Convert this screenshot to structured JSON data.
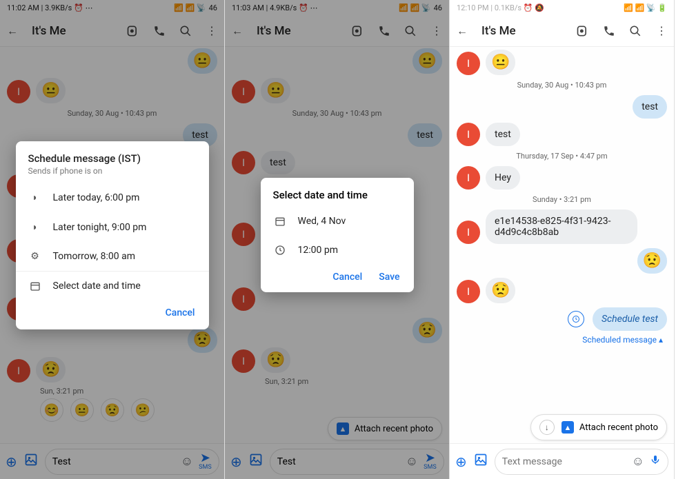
{
  "panel1": {
    "status": {
      "time": "11:02 AM",
      "speed": "3.9KB/s",
      "battery": "46"
    },
    "title": "It's Me",
    "chat": {
      "ts1": "Sunday, 30 Aug • 10:43 pm",
      "sent_test": "test",
      "sun_ts": "Sun, 3:21 pm"
    },
    "dialog": {
      "title": "Schedule message (IST)",
      "sub": "Sends if phone is on",
      "opt1": "Later today, 6:00 pm",
      "opt2": "Later tonight, 9:00 pm",
      "opt3": "Tomorrow, 8:00 am",
      "opt4": "Select date and time",
      "cancel": "Cancel"
    },
    "input": {
      "value": "Test",
      "send_label": "SMS"
    }
  },
  "panel2": {
    "status": {
      "time": "11:03 AM",
      "speed": "4.9KB/s",
      "battery": "46"
    },
    "title": "It's Me",
    "chat": {
      "ts1": "Sunday, 30 Aug • 10:43 pm",
      "sent_test": "test",
      "recv_test": "test",
      "sun_ts": "Sun, 3:21 pm",
      "attach": "Attach recent photo"
    },
    "dialog": {
      "title": "Select date and time",
      "date": "Wed, 4 Nov",
      "time": "12:00 pm",
      "cancel": "Cancel",
      "save": "Save"
    },
    "input": {
      "value": "Test",
      "send_label": "SMS"
    }
  },
  "panel3": {
    "status": {
      "time": "12:10 PM",
      "speed": "0.1KB/s"
    },
    "title": "It's Me",
    "chat": {
      "ts1": "Sunday, 30 Aug • 10:43 pm",
      "sent_test": "test",
      "recv_test": "test",
      "ts2": "Thursday, 17 Sep • 4:47 pm",
      "recv_hey": "Hey",
      "ts3": "Sunday • 3:21 pm",
      "recv_uuid": "e1e14538-e825-4f31-9423-d4d9c4c8b8ab",
      "sched_text": "Schedule test",
      "sched_link": "Scheduled message ▴",
      "attach": "Attach recent photo"
    },
    "input": {
      "placeholder": "Text message"
    }
  },
  "icons": {
    "back": "←",
    "video": "⦿",
    "call": "✆",
    "search": "⌕",
    "more": "⋮",
    "moon": "◗",
    "gear": "⚙",
    "calendar": "📅",
    "clock": "🕐",
    "plus": "⊕",
    "gallery": "🖼",
    "smile": "☺",
    "send": "➤",
    "mic": "🎤"
  }
}
